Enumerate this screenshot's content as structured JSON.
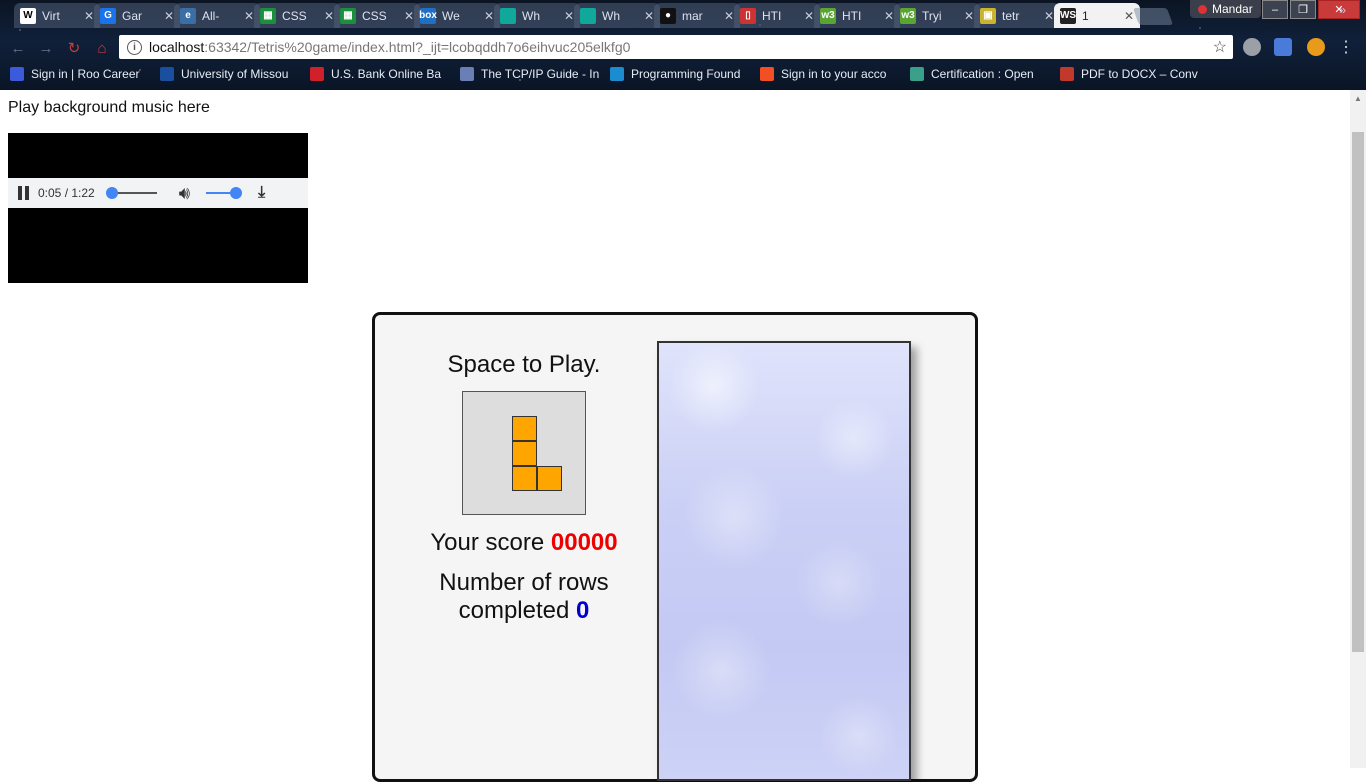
{
  "browser": {
    "tabs": [
      {
        "title": "Virt",
        "icon": "wikipedia-icon",
        "color": "#ffffff"
      },
      {
        "title": "Gar",
        "icon": "ga-icon",
        "color": "#1a73e8"
      },
      {
        "title": "All-",
        "icon": "globe-icon",
        "color": "#3a6ea5"
      },
      {
        "title": "CSS",
        "icon": "sheets-icon",
        "color": "#1e8e3e"
      },
      {
        "title": "CSS",
        "icon": "sheets-icon",
        "color": "#1e8e3e"
      },
      {
        "title": "We",
        "icon": "box-icon",
        "color": "#1f6fc5"
      },
      {
        "title": "Wh",
        "icon": "teal-square-icon",
        "color": "#10a89a"
      },
      {
        "title": "Wh",
        "icon": "teal-square-icon",
        "color": "#10a89a"
      },
      {
        "title": "mar",
        "icon": "github-icon",
        "color": "#111111"
      },
      {
        "title": "HTI",
        "icon": "document-icon",
        "color": "#cc3333"
      },
      {
        "title": "HTI",
        "icon": "w3-icon",
        "color": "#5aa532"
      },
      {
        "title": "Tryi",
        "icon": "w3-icon",
        "color": "#5aa532"
      },
      {
        "title": "tetr",
        "icon": "tetris-icon",
        "color": "#c8b432"
      },
      {
        "title": "1",
        "icon": "webstorm-icon",
        "color": "#222222"
      }
    ],
    "profile_name": "Mandar",
    "url_host": "localhost",
    "url_path": ":63342/Tetris%20game/index.html?_ijt=lcobqddh7o6eihvuc205elkfg0",
    "bookmarks": [
      {
        "label": "Sign in | Roo Career",
        "color": "#3b5bdb"
      },
      {
        "label": "University of Missou",
        "color": "#1a4fa0"
      },
      {
        "label": "U.S. Bank Online Ba",
        "color": "#d0202a"
      },
      {
        "label": "The TCP/IP Guide - In",
        "color": "#6a7fb5"
      },
      {
        "label": "Programming Found",
        "color": "#1c8cd1"
      },
      {
        "label": "Sign in to your acco",
        "color": "#f25022"
      },
      {
        "label": "Certification : Open",
        "color": "#3aa08a"
      },
      {
        "label": "PDF to DOCX – Conv",
        "color": "#c0392b"
      }
    ]
  },
  "page": {
    "music_label": "Play background music here",
    "audio_time": "0:05 / 1:22",
    "audio_progress": 0.061,
    "volume_level": 0.8
  },
  "game": {
    "prompt": "Space to Play.",
    "score_label": "Your score",
    "score_value": "00000",
    "rows_label": "Number of rows completed",
    "rows_value": "0",
    "next_piece": "L",
    "piece_color": "#ffa500"
  }
}
